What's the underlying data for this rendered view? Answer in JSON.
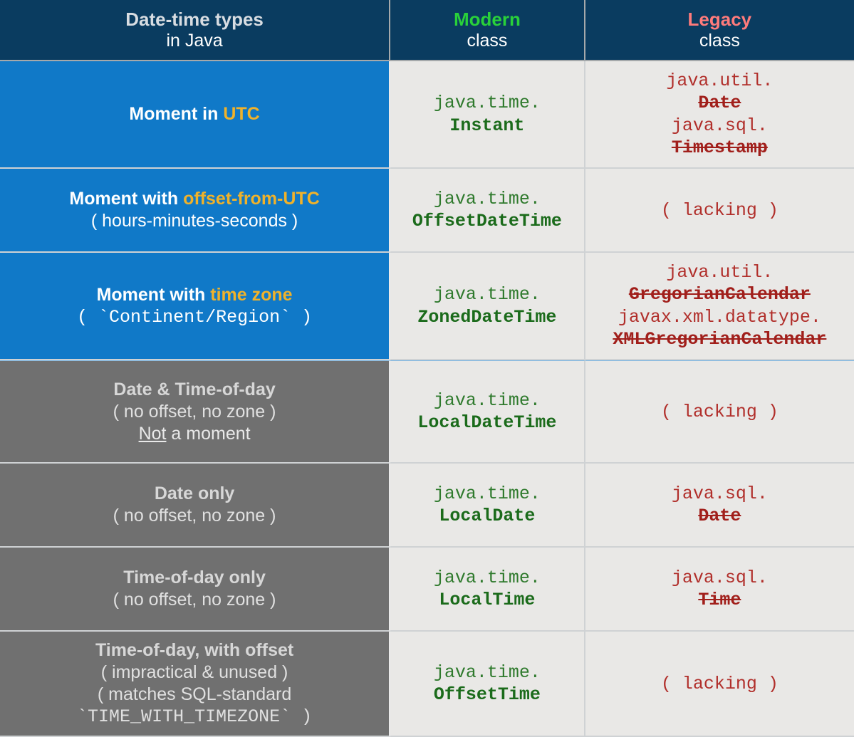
{
  "header": {
    "col1_line1": "Date-time types",
    "col1_line2": "in Java",
    "col2_line1": "Modern",
    "col2_line2": "class",
    "col3_line1": "Legacy",
    "col3_line2": "class"
  },
  "rows": [
    {
      "left_title_pre": "Moment in ",
      "left_title_accent": "UTC",
      "left_paren": "",
      "left_note": "",
      "modern_pkg": "java.time.",
      "modern_cls": "Instant",
      "legacy": [
        {
          "pkg": "java.util.",
          "cls": "Date"
        },
        {
          "pkg": "java.sql.",
          "cls": "Timestamp"
        }
      ],
      "legacy_lacking": ""
    },
    {
      "left_title_pre": "Moment with ",
      "left_title_accent": "offset-from-UTC",
      "left_paren": "( hours-minutes-seconds )",
      "left_note": "",
      "modern_pkg": "java.time.",
      "modern_cls": "OffsetDateTime",
      "legacy": [],
      "legacy_lacking": "( lacking )"
    },
    {
      "left_title_pre": "Moment with ",
      "left_title_accent": "time zone",
      "left_paren": "( `Continent/Region` )",
      "left_note": "",
      "modern_pkg": "java.time.",
      "modern_cls": "ZonedDateTime",
      "legacy": [
        {
          "pkg": "java.util.",
          "cls": "GregorianCalendar"
        },
        {
          "pkg": "javax.xml.datatype.",
          "cls": "XMLGregorianCalendar"
        }
      ],
      "legacy_lacking": ""
    },
    {
      "left_title_pre": "Date & Time-of-day",
      "left_title_accent": "",
      "left_paren": "( no offset, no zone )",
      "left_note_pre": "",
      "left_note_ul": "Not",
      "left_note_post": " a moment",
      "modern_pkg": "java.time.",
      "modern_cls": "LocalDateTime",
      "legacy": [],
      "legacy_lacking": "( lacking )"
    },
    {
      "left_title_pre": "Date only",
      "left_title_accent": "",
      "left_paren": "( no offset, no zone )",
      "left_note": "",
      "modern_pkg": "java.time.",
      "modern_cls": "LocalDate",
      "legacy": [
        {
          "pkg": "java.sql.",
          "cls": "Date"
        }
      ],
      "legacy_lacking": ""
    },
    {
      "left_title_pre": "Time-of-day only",
      "left_title_accent": "",
      "left_paren": "( no offset, no zone )",
      "left_note": "",
      "modern_pkg": "java.time.",
      "modern_cls": "LocalTime",
      "legacy": [
        {
          "pkg": "java.sql.",
          "cls": "Time"
        }
      ],
      "legacy_lacking": ""
    },
    {
      "left_title_pre": "Time-of-day, with offset",
      "left_title_accent": "",
      "left_paren": "( impractical & unused )",
      "left_note2": "( matches SQL-standard",
      "left_note3": "`TIME_WITH_TIMEZONE` )",
      "modern_pkg": "java.time.",
      "modern_cls": "OffsetTime",
      "legacy": [],
      "legacy_lacking": "( lacking )"
    }
  ]
}
